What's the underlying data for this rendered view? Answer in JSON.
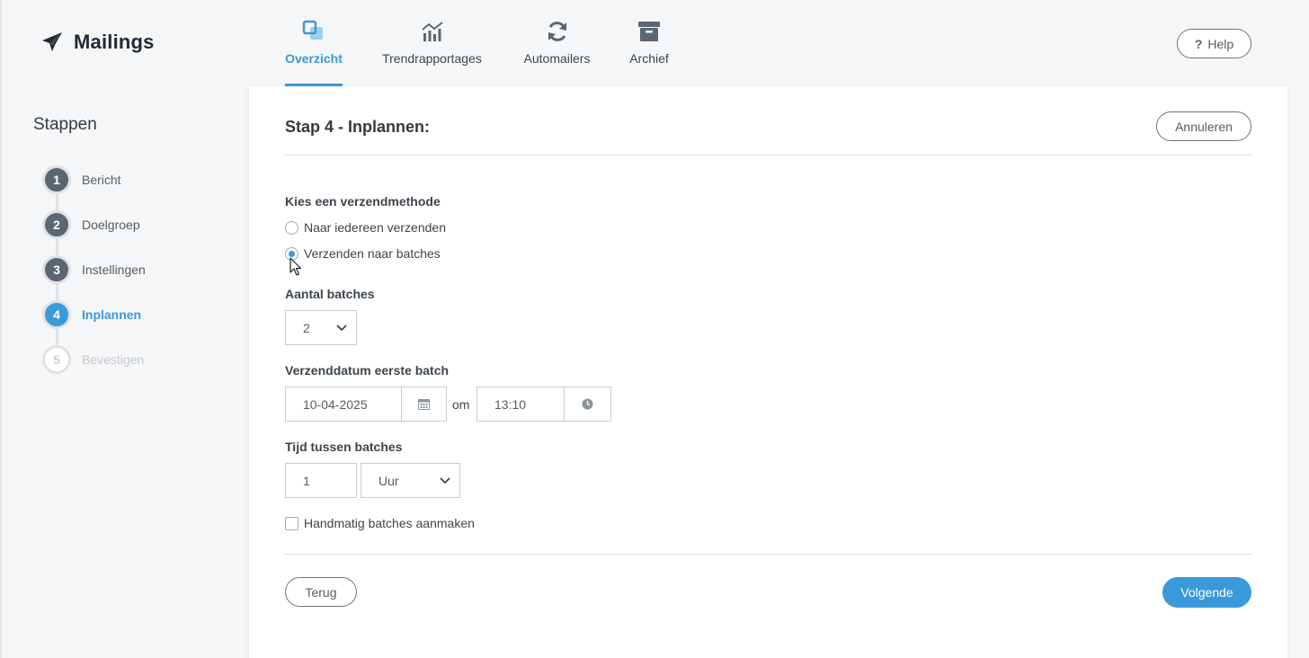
{
  "app": {
    "title": "Mailings",
    "logo_icon": "paper-plane-icon"
  },
  "nav": {
    "items": [
      {
        "label": "Overzicht",
        "icon": "overview-icon",
        "active": true
      },
      {
        "label": "Trendrapportages",
        "icon": "chart-icon",
        "active": false
      },
      {
        "label": "Automailers",
        "icon": "refresh-icon",
        "active": false
      },
      {
        "label": "Archief",
        "icon": "archive-icon",
        "active": false
      }
    ],
    "help": "Help",
    "help_glyph": "?"
  },
  "sidebar": {
    "title": "Stappen",
    "steps": [
      {
        "num": "1",
        "label": "Bericht",
        "state": "done"
      },
      {
        "num": "2",
        "label": "Doelgroep",
        "state": "done"
      },
      {
        "num": "3",
        "label": "Instellingen",
        "state": "done"
      },
      {
        "num": "4",
        "label": "Inplannen",
        "state": "current"
      },
      {
        "num": "5",
        "label": "Bevestigen",
        "state": "future"
      }
    ]
  },
  "main": {
    "title": "Stap 4 - Inplannen:",
    "cancel": "Annuleren",
    "send_method": {
      "label": "Kies een verzendmethode",
      "options": [
        {
          "label": "Naar iedereen verzenden",
          "checked": false
        },
        {
          "label": "Verzenden naar batches",
          "checked": true
        }
      ]
    },
    "batches": {
      "label": "Aantal batches",
      "value": "2"
    },
    "first_batch": {
      "label": "Verzenddatum eerste batch",
      "date": "10-04-2025",
      "connector": "om",
      "time": "13:10"
    },
    "interval": {
      "label": "Tijd tussen batches",
      "amount": "1",
      "unit": "Uur"
    },
    "manual": {
      "label": "Handmatig batches aanmaken",
      "checked": false
    },
    "back": "Terug",
    "next": "Volgende"
  },
  "colors": {
    "accent": "#3a9ad9",
    "step_done": "#5c6670",
    "text": "#333a40"
  }
}
